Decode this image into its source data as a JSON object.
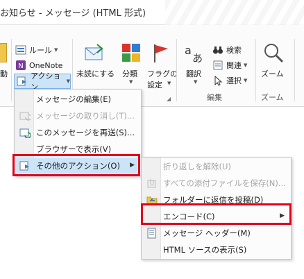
{
  "window": {
    "title": "お知らせ - メッセージ (HTML 形式)"
  },
  "ribbon": {
    "move_partial": "動",
    "rules": "ルール",
    "onenote": "OneNote",
    "actions": "アクション",
    "mark_unread": "未読にする",
    "categorize": "分類",
    "followup_line1": "フラグの",
    "followup_line2": "設定",
    "translate": "翻訳",
    "search": "検索",
    "related": "関連",
    "select": "選択",
    "zoom": "ズーム",
    "group_edit": "編集",
    "group_zoom": "ズーム"
  },
  "actions_menu": {
    "items": [
      {
        "label": "メッセージの編集(E)",
        "disabled": false
      },
      {
        "label": "メッセージの取り消し(T)...",
        "disabled": true
      },
      {
        "label": "このメッセージを再送(S)...",
        "disabled": false
      },
      {
        "label": "ブラウザーで表示(V)",
        "disabled": false
      },
      {
        "label": "その他のアクション(O)",
        "disabled": false
      }
    ]
  },
  "other_actions_menu": {
    "items": [
      {
        "label": "折り返しを解除(U)",
        "disabled": true
      },
      {
        "label": "すべての添付ファイルを保存(N)...",
        "disabled": true
      },
      {
        "label": "フォルダーに返信を投稿(D)",
        "disabled": false
      },
      {
        "label": "エンコード(C)",
        "disabled": false
      },
      {
        "label": "メッセージ ヘッダー(M)",
        "disabled": false
      },
      {
        "label": "HTML ソースの表示(S)",
        "disabled": false
      }
    ]
  },
  "colors": {
    "accent": "#0078d7",
    "highlight_bg": "#cce4f7",
    "annotation_red": "#e0001a",
    "flag_red": "#d9342b"
  }
}
